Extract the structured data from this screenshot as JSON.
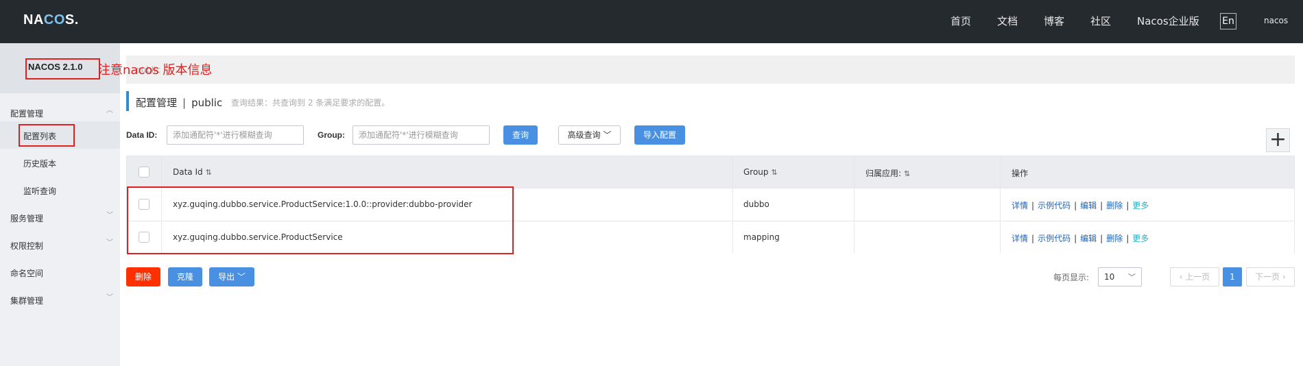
{
  "header": {
    "logo_prefix": "NA",
    "logo_mid": "CO",
    "logo_suffix": "S.",
    "nav": [
      "首页",
      "文档",
      "博客",
      "社区",
      "Nacos企业版"
    ],
    "lang_button": "En",
    "user": "nacos"
  },
  "sidebar": {
    "version": "NACOS 2.1.0",
    "items": [
      {
        "label": "配置管理",
        "expanded": true
      },
      {
        "label": "配置列表",
        "sub": true,
        "active": true
      },
      {
        "label": "历史版本",
        "sub": true
      },
      {
        "label": "监听查询",
        "sub": true
      },
      {
        "label": "服务管理",
        "expanded": false
      },
      {
        "label": "权限控制",
        "expanded": false
      },
      {
        "label": "命名空间"
      },
      {
        "label": "集群管理",
        "expanded": false
      }
    ]
  },
  "annotation": {
    "text": "注意nacos 版本信息",
    "color": "#e02020"
  },
  "main": {
    "banner_ghost": "public",
    "title": "配置管理",
    "namespace": "public",
    "title_sep": "|",
    "result_info": "查询结果：共查询到 2 条满足要求的配置。",
    "filters": {
      "data_id_label": "Data ID:",
      "data_id_placeholder": "添加通配符'*'进行模糊查询",
      "group_label": "Group:",
      "group_placeholder": "添加通配符'*'进行模糊查询",
      "search_button": "查询",
      "advanced_button": "高级查询",
      "import_button": "导入配置"
    },
    "add_button": "+",
    "table": {
      "columns": [
        "Data Id",
        "Group",
        "归属应用:",
        "操作"
      ],
      "rows": [
        {
          "data_id": "xyz.guqing.dubbo.service.ProductService:1.0.0::provider:dubbo-provider",
          "group": "dubbo",
          "app": ""
        },
        {
          "data_id": "xyz.guqing.dubbo.service.ProductService",
          "group": "mapping",
          "app": ""
        }
      ],
      "ops": [
        "详情",
        "示例代码",
        "编辑",
        "删除",
        "更多"
      ],
      "op_sep": "|"
    },
    "bulk": {
      "delete": "删除",
      "clone": "克隆",
      "export": "导出"
    },
    "pagination": {
      "page_size_label": "每页显示:",
      "page_size": "10",
      "prev": "上一页",
      "current": "1",
      "next": "下一页"
    }
  },
  "colors": {
    "topbar": "#252a2f",
    "primary": "#4a90e2",
    "danger": "#ff3000",
    "link": "#1e63b8",
    "more_link": "#22b3c8"
  }
}
